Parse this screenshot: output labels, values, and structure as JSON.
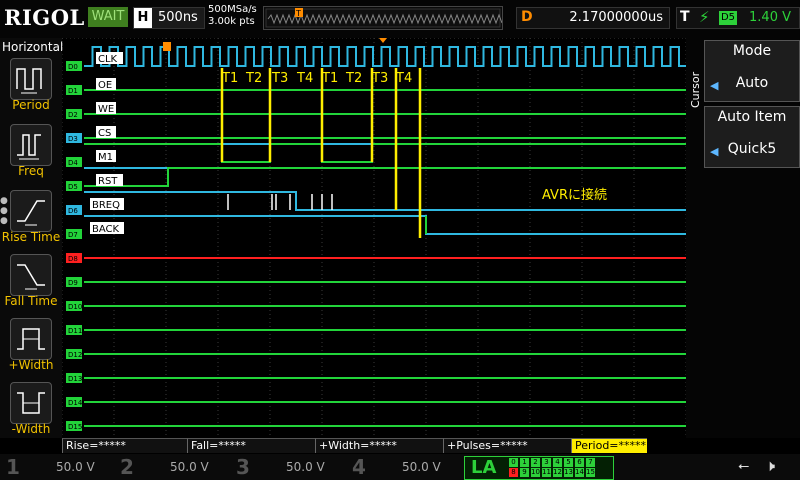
{
  "topbar": {
    "logo": "RIGOL",
    "run_status": "WAIT",
    "h_key": "H",
    "timebase": "500ns",
    "sample_rate": "500MSa/s",
    "points": "3.00k pts",
    "trigger_pos_key": "D",
    "trigger_position": "2.17000000us",
    "trigger_key": "T",
    "trigger_source": "D5",
    "trigger_level": "1.40 V"
  },
  "left_panel": {
    "title": "Horizontal",
    "buttons": [
      {
        "label": "Period",
        "icon": "period-icon"
      },
      {
        "label": "Freq",
        "icon": "freq-icon"
      },
      {
        "label": "Rise Time",
        "icon": "rise-time-icon"
      },
      {
        "label": "Fall Time",
        "icon": "fall-time-icon"
      },
      {
        "label": "+Width",
        "icon": "pos-width-icon"
      },
      {
        "label": "-Width",
        "icon": "neg-width-icon"
      }
    ]
  },
  "right_panel": {
    "side_label": "Cursor",
    "mode_title": "Mode",
    "mode_value": "Auto",
    "item_title": "Auto Item",
    "item_value": "Quick5"
  },
  "channels": {
    "tags": [
      "D0",
      "D1",
      "D2",
      "D3",
      "D4",
      "D5",
      "D6",
      "D7",
      "D8",
      "D9",
      "D10",
      "D11",
      "D12",
      "D13",
      "D14",
      "D15"
    ],
    "signal_labels": [
      "CLK",
      "OE",
      "WE",
      "CS",
      "M1",
      "RST",
      "BREQ",
      "BACK"
    ],
    "colors": {
      "green": "#22d43a",
      "cyan": "#2fb8e0",
      "red": "#ff2020",
      "yellow": "#ffee00",
      "marker": "#ff8c00"
    }
  },
  "annotations": {
    "cycle_labels": [
      "T1",
      "T2",
      "T3",
      "T4",
      "T1",
      "T2",
      "T3",
      "T4"
    ],
    "note": "AVRに接続"
  },
  "measurements": {
    "rise": "Rise=*****",
    "fall": "Fall=*****",
    "pos_width": "+Width=*****",
    "pulses": "+Pulses=*****",
    "period": "Period=*****"
  },
  "bottombar": {
    "ch1": {
      "num": "1",
      "scale": "50.0 V"
    },
    "ch2": {
      "num": "2",
      "scale": "50.0 V"
    },
    "ch3": {
      "num": "3",
      "scale": "50.0 V"
    },
    "ch4": {
      "num": "4",
      "scale": "50.0 V"
    },
    "la_label": "LA",
    "la_digits_top": [
      "0",
      "1",
      "2",
      "3",
      "4",
      "5",
      "6",
      "7"
    ],
    "la_digits_bottom": [
      "8",
      "9",
      "10",
      "11",
      "12",
      "13",
      "14",
      "15"
    ]
  }
}
